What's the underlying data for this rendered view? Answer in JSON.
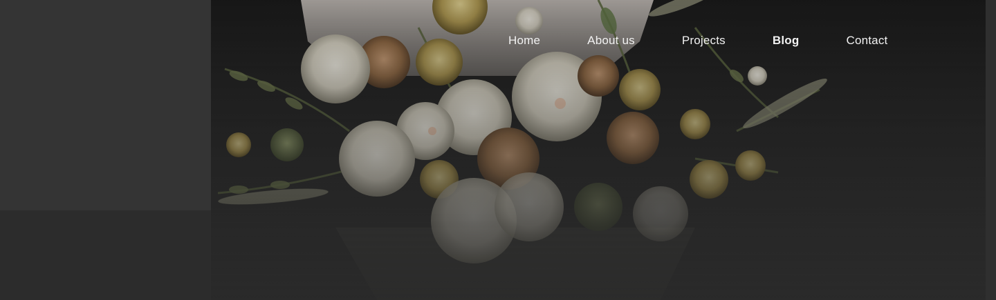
{
  "nav": {
    "items": [
      {
        "label": "Home"
      },
      {
        "label": "About us"
      },
      {
        "label": "Projects"
      },
      {
        "label": "Blog"
      },
      {
        "label": "Contact"
      }
    ],
    "active": "Blog"
  },
  "hero": {
    "image": "flower-bouquet-photo"
  },
  "colors": {
    "background": "#2a2a2a",
    "panel": "#343434",
    "nav_text": "#f2f2f2"
  }
}
